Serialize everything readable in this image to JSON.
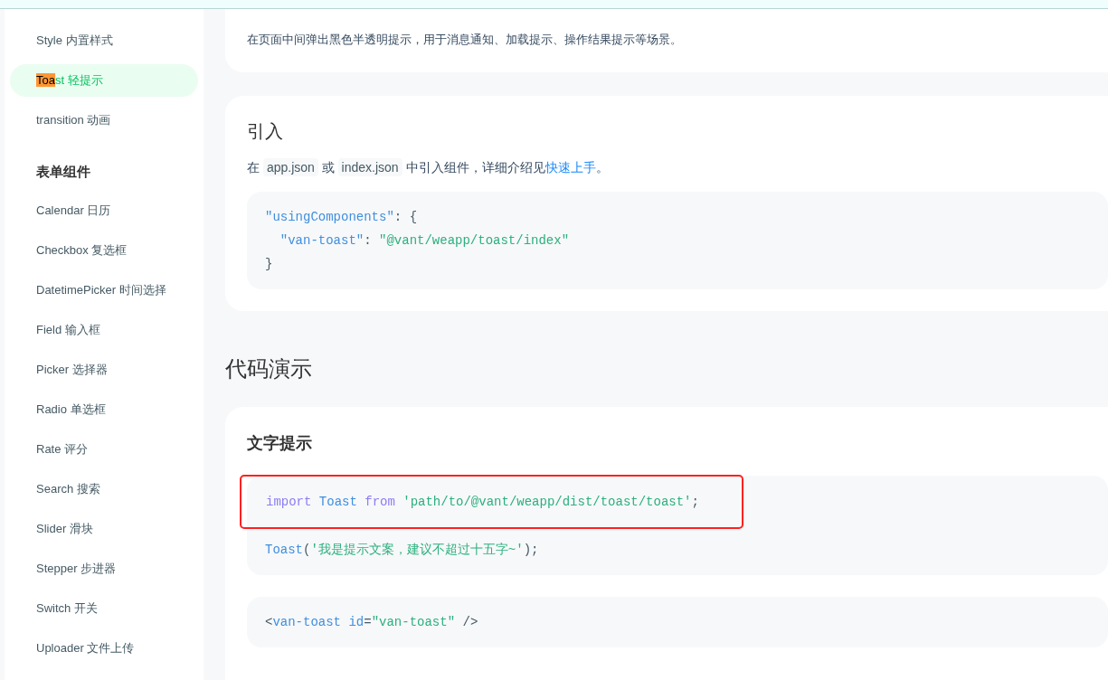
{
  "sidebar": {
    "items": [
      {
        "kind": "item",
        "label": "Style 内置样式",
        "selected": false
      },
      {
        "kind": "item",
        "match": "Toa",
        "label": "st 轻提示",
        "selected": true
      },
      {
        "kind": "item",
        "label": "transition 动画",
        "selected": false
      },
      {
        "kind": "group",
        "label": "表单组件"
      },
      {
        "kind": "item",
        "label": "Calendar 日历",
        "selected": false
      },
      {
        "kind": "item",
        "label": "Checkbox 复选框",
        "selected": false
      },
      {
        "kind": "item",
        "label": "DatetimePicker 时间选择",
        "selected": false
      },
      {
        "kind": "item",
        "label": "Field 输入框",
        "selected": false
      },
      {
        "kind": "item",
        "label": "Picker 选择器",
        "selected": false
      },
      {
        "kind": "item",
        "label": "Radio 单选框",
        "selected": false
      },
      {
        "kind": "item",
        "label": "Rate 评分",
        "selected": false
      },
      {
        "kind": "item",
        "label": "Search 搜索",
        "selected": false
      },
      {
        "kind": "item",
        "label": "Slider 滑块",
        "selected": false
      },
      {
        "kind": "item",
        "label": "Stepper 步进器",
        "selected": false
      },
      {
        "kind": "item",
        "label": "Switch 开关",
        "selected": false
      },
      {
        "kind": "item",
        "label": "Uploader 文件上传",
        "selected": false
      }
    ]
  },
  "intro_card": {
    "text": "在页面中间弹出黑色半透明提示，用于消息通知、加载提示、操作结果提示等场景。"
  },
  "import_card": {
    "title": "引入",
    "paragraph": [
      {
        "kind": "text",
        "text": "在 "
      },
      {
        "kind": "code",
        "text": "app.json"
      },
      {
        "kind": "text",
        "text": " 或 "
      },
      {
        "kind": "code",
        "text": "index.json"
      },
      {
        "kind": "text",
        "text": " 中引入组件，详细介绍见"
      },
      {
        "kind": "link",
        "text": "快速上手"
      },
      {
        "kind": "text",
        "text": "。"
      }
    ],
    "code": [
      [
        {
          "kind": "name",
          "text": "\"usingComponents\""
        },
        {
          "kind": "punct",
          "text": ": {"
        }
      ],
      [
        {
          "kind": "name",
          "text": "  \"van-toast\""
        },
        {
          "kind": "punct",
          "text": ": "
        },
        {
          "kind": "string",
          "text": "\"@vant/weapp/toast/index\""
        }
      ],
      [
        {
          "kind": "punct",
          "text": "}"
        }
      ]
    ]
  },
  "demo_heading": "代码演示",
  "demo_card": {
    "title": "文字提示",
    "blocks": [
      {
        "lines": [
          {
            "kind": "code",
            "framed": true,
            "tokens": [
              {
                "kind": "keyword",
                "text": "import"
              },
              {
                "kind": "name",
                "text": " Toast"
              },
              {
                "kind": "keyword",
                "text": " from"
              },
              {
                "kind": "string",
                "text": " 'path/to/@vant/weapp/dist/toast/toast'"
              },
              {
                "kind": "punct",
                "text": ";"
              }
            ]
          },
          {
            "kind": "blank"
          },
          {
            "kind": "code",
            "framed": false,
            "tokens": [
              {
                "kind": "name",
                "text": "Toast"
              },
              {
                "kind": "punct",
                "text": "("
              },
              {
                "kind": "string",
                "text": "'我是提示文案，建议不超过十五字~'"
              },
              {
                "kind": "punct",
                "text": ");"
              }
            ]
          }
        ]
      },
      {
        "lines": [
          {
            "kind": "code",
            "framed": false,
            "tokens": [
              {
                "kind": "punct",
                "text": "<"
              },
              {
                "kind": "name",
                "text": "van-toast"
              },
              {
                "kind": "name",
                "text": " id"
              },
              {
                "kind": "punct",
                "text": "="
              },
              {
                "kind": "string",
                "text": "\"van-toast\""
              },
              {
                "kind": "punct",
                "text": " />"
              }
            ]
          }
        ]
      }
    ]
  }
}
